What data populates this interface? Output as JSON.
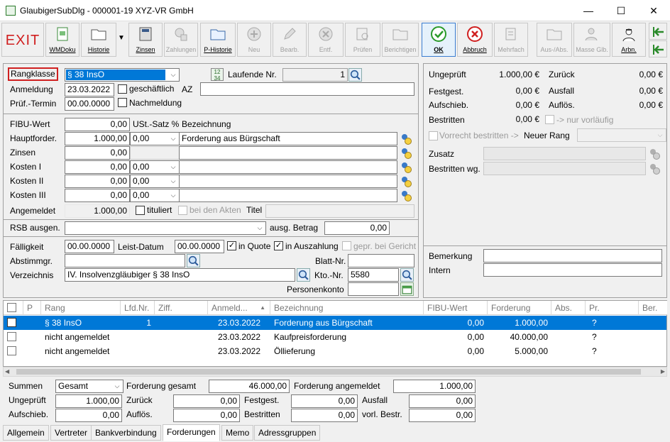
{
  "window": {
    "title": "GlaubigerSubDlg - 000001-19 XYZ-VR GmbH",
    "minimize": "—",
    "maximize": "☐",
    "close": "✕"
  },
  "toolbar": {
    "exit": "EXIT",
    "buttons": [
      {
        "label": "WMDoku",
        "enabled": true
      },
      {
        "label": "Historie",
        "enabled": true
      },
      {
        "label": "Zinsen",
        "enabled": true
      },
      {
        "label": "Zahlungen",
        "enabled": false
      },
      {
        "label": "P-Historie",
        "enabled": true
      },
      {
        "label": "Neu",
        "enabled": false
      },
      {
        "label": "Bearb.",
        "enabled": false
      },
      {
        "label": "Entf.",
        "enabled": false
      },
      {
        "label": "Prüfen",
        "enabled": false
      },
      {
        "label": "Berichtigen",
        "enabled": false
      },
      {
        "label": "OK",
        "enabled": true
      },
      {
        "label": "Abbruch",
        "enabled": true
      },
      {
        "label": "Mehrfach",
        "enabled": false
      },
      {
        "label": "Aus-/Abs.",
        "enabled": false
      },
      {
        "label": "Masse Glb.",
        "enabled": false
      },
      {
        "label": "Arbn.",
        "enabled": true
      }
    ]
  },
  "form": {
    "rangklasse_label": "Rangklasse",
    "rangklasse_value": "§ 38 InsO",
    "laufende_nr_label": "Laufende Nr.",
    "laufende_nr_value": "1",
    "anmeldung_label": "Anmeldung",
    "anmeldung_value": "23.03.2022",
    "geschaeftlich_label": "geschäftlich",
    "az_label": "AZ",
    "az_value": "",
    "pruef_termin_label": "Prüf.-Termin",
    "pruef_termin_value": "00.00.0000",
    "nachmeldung_label": "Nachmeldung",
    "fibu_wert_label": "FIBU-Wert",
    "fibu_wert_value": "0,00",
    "ust_satz_label": "USt.-Satz %",
    "bezeichnung_label": "Bezeichnung",
    "rows": [
      {
        "label": "Hauptforder.",
        "amount": "1.000,00",
        "ust": "0,00",
        "desc": "Forderung aus Bürgschaft",
        "has_ust": true
      },
      {
        "label": "Zinsen",
        "amount": "0,00",
        "ust": "",
        "desc": "",
        "has_ust": false
      },
      {
        "label": "Kosten I",
        "amount": "0,00",
        "ust": "0,00",
        "desc": "",
        "has_ust": true
      },
      {
        "label": "Kosten II",
        "amount": "0,00",
        "ust": "0,00",
        "desc": "",
        "has_ust": true
      },
      {
        "label": "Kosten III",
        "amount": "0,00",
        "ust": "0,00",
        "desc": "",
        "has_ust": true
      }
    ],
    "angemeldet_label": "Angemeldet",
    "angemeldet_value": "1.000,00",
    "tituliert_label": "tituliert",
    "bei_den_akten_label": "bei den Akten",
    "titel_label": "Titel",
    "rsb_label": "RSB ausgen.",
    "ausg_betrag_label": "ausg. Betrag",
    "ausg_betrag_value": "0,00",
    "faelligkeit_label": "Fälligkeit",
    "faelligkeit_value": "00.00.0000",
    "leist_datum_label": "Leist-Datum",
    "leist_datum_value": "00.00.0000",
    "in_quote_label": "in Quote",
    "in_auszahlung_label": "in Auszahlung",
    "gepr_label": "gepr. bei Gericht",
    "abstimmgr_label": "Abstimmgr.",
    "blatt_nr_label": "Blatt-Nr.",
    "verzeichnis_label": "Verzeichnis",
    "verzeichnis_value": "IV. Insolvenzgläubiger § 38 InsO",
    "kto_nr_label": "Kto.-Nr.",
    "kto_nr_value": "5580",
    "personenkonto_label": "Personenkonto"
  },
  "right": {
    "ungeprueft_label": "Ungeprüft",
    "ungeprueft_value": "1.000,00 €",
    "zurueck_label": "Zurück",
    "zurueck_value": "0,00 €",
    "festgest_label": "Festgest.",
    "festgest_value": "0,00 €",
    "ausfall_label": "Ausfall",
    "ausfall_value": "0,00 €",
    "aufschieb_label": "Aufschieb.",
    "aufschieb_value": "0,00 €",
    "aufloes_label": "Auflös.",
    "aufloes_value": "0,00 €",
    "bestritten_label": "Bestritten",
    "bestritten_value": "0,00 €",
    "nur_vorlaeufig_label": "-> nur vorläufig",
    "vorrecht_label": "Vorrecht bestritten ->",
    "neuer_rang_label": "Neuer Rang",
    "zusatz_label": "Zusatz",
    "bestritten_wg_label": "Bestritten wg.",
    "bemerkung_label": "Bemerkung",
    "intern_label": "Intern"
  },
  "grid": {
    "headers": [
      "P",
      "Rang",
      "Lfd.Nr.",
      "Ziff.",
      "Anmeld...",
      "Bezeichnung",
      "FIBU-Wert",
      "Forderung",
      "Abs.",
      "Pr.",
      "Ber."
    ],
    "sort_icon": "▲",
    "rows": [
      {
        "rang": "§ 38 InsO",
        "lfd": "1",
        "ziff": "",
        "anmeld": "23.03.2022",
        "bez": "Forderung aus Bürgschaft",
        "fibu": "0,00",
        "ford": "1.000,00",
        "abs": "",
        "pr": "?",
        "ber": "",
        "selected": true
      },
      {
        "rang": "nicht angemeldet",
        "lfd": "",
        "ziff": "",
        "anmeld": "23.03.2022",
        "bez": "Kaufpreisforderung",
        "fibu": "0,00",
        "ford": "40.000,00",
        "abs": "",
        "pr": "?",
        "ber": "",
        "selected": false
      },
      {
        "rang": "nicht angemeldet",
        "lfd": "",
        "ziff": "",
        "anmeld": "23.03.2022",
        "bez": "Öllieferung",
        "fibu": "0,00",
        "ford": "5.000,00",
        "abs": "",
        "pr": "?",
        "ber": "",
        "selected": false
      }
    ]
  },
  "summary": {
    "summen_label": "Summen",
    "summen_value": "Gesamt",
    "forderung_gesamt_label": "Forderung gesamt",
    "forderung_gesamt_value": "46.000,00",
    "forderung_angemeldet_label": "Forderung angemeldet",
    "forderung_angemeldet_value": "1.000,00",
    "ungeprueft_label": "Ungeprüft",
    "ungeprueft_value": "1.000,00",
    "zurueck_label": "Zurück",
    "zurueck_value": "0,00",
    "festgest_label": "Festgest.",
    "festgest_value": "0,00",
    "ausfall_label": "Ausfall",
    "ausfall_value": "0,00",
    "aufschieb_label": "Aufschieb.",
    "aufschieb_value": "0,00",
    "aufloes_label": "Auflös.",
    "aufloes_value": "0,00",
    "bestritten_label": "Bestritten",
    "bestritten_value": "0,00",
    "vorl_bestr_label": "vorl. Bestr.",
    "vorl_bestr_value": "0,00"
  },
  "tabs": [
    "Allgemein",
    "Vertreter",
    "Bankverbindung",
    "Forderungen",
    "Memo",
    "Adressgruppen"
  ],
  "active_tab": "Forderungen"
}
